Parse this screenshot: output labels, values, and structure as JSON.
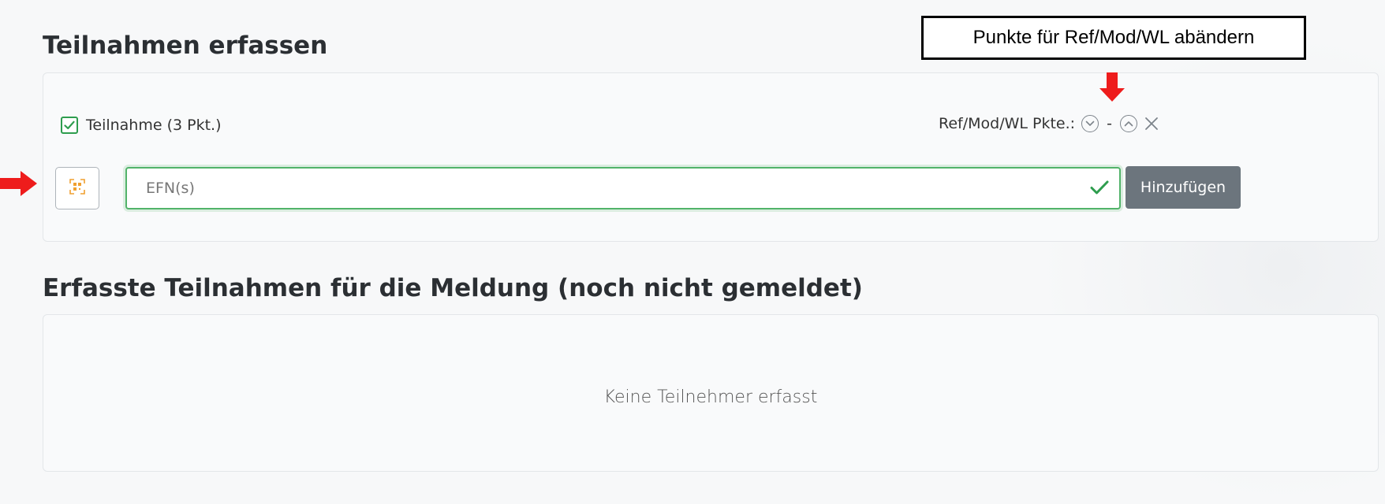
{
  "section1": {
    "title": "Teilnahmen erfassen",
    "participation_label": "Teilnahme (3 Pkt.)",
    "points_label": "Ref/Mod/WL Pkte.:",
    "points_separator": "-",
    "efn_placeholder": "EFN(s)",
    "add_button_label": "Hinzufügen"
  },
  "section2": {
    "title": "Erfasste Teilnahmen für die Meldung (noch nicht gemeldet)",
    "empty_text": "Keine Teilnehmer erfasst"
  },
  "annotation": {
    "callout_text": "Punkte für Ref/Mod/WL abändern",
    "arrow_color": "#ee1c1c"
  },
  "icons": {
    "checkbox": "checkbox-checked-icon",
    "decrease": "chevron-down-circle-icon",
    "increase": "chevron-up-circle-icon",
    "remove": "close-icon",
    "scan": "qr-code-scan-icon",
    "valid": "check-icon"
  },
  "colors": {
    "success_green": "#2e9d4e",
    "button_gray": "#6c757d",
    "scan_icon_orange": "#f0a030"
  }
}
